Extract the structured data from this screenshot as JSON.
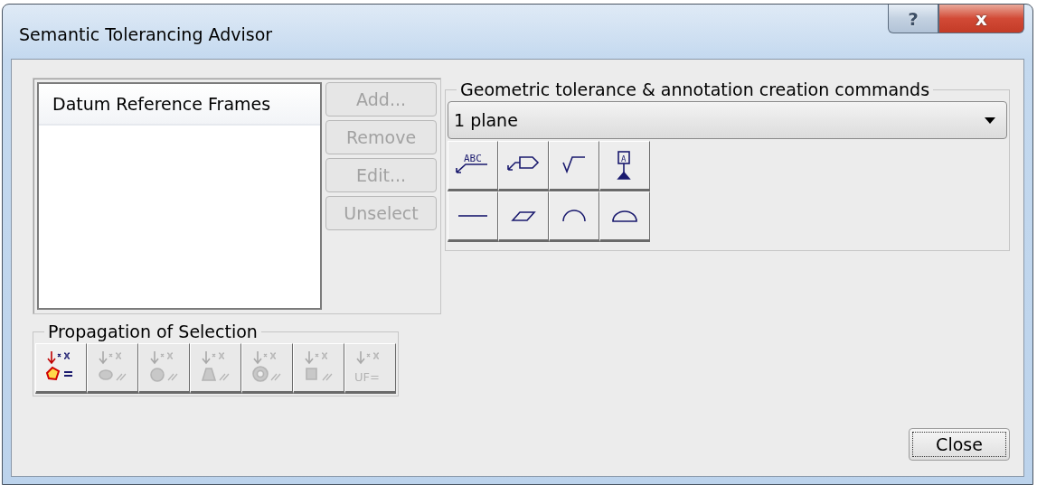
{
  "window": {
    "title": "Semantic Tolerancing Advisor",
    "help": "?",
    "close": "x"
  },
  "list": {
    "items": [
      {
        "label": "Datum Reference Frames",
        "selected": true
      }
    ]
  },
  "list_buttons": [
    {
      "label": "Add...",
      "disabled": true
    },
    {
      "label": "Remove",
      "disabled": true
    },
    {
      "label": "Edit...",
      "disabled": true
    },
    {
      "label": "Unselect",
      "disabled": true
    }
  ],
  "commands": {
    "title": "Geometric tolerance & annotation creation commands",
    "dropdown": {
      "value": "1 plane"
    },
    "tools": [
      {
        "kind": "text-leader",
        "label": "ABC"
      },
      {
        "kind": "flag-leader"
      },
      {
        "kind": "roughness"
      },
      {
        "kind": "datum-target",
        "label": "A"
      },
      {
        "kind": "line"
      },
      {
        "kind": "plane"
      },
      {
        "kind": "arc"
      },
      {
        "kind": "half-disc"
      }
    ]
  },
  "propagation": {
    "title": "Propagation of Selection",
    "tools": [
      {
        "kind": "face",
        "disabled": false
      },
      {
        "kind": "cylinder",
        "disabled": true
      },
      {
        "kind": "sphere",
        "disabled": true
      },
      {
        "kind": "cone",
        "disabled": true
      },
      {
        "kind": "torus",
        "disabled": true
      },
      {
        "kind": "feature",
        "disabled": true
      },
      {
        "kind": "user-feature",
        "label": "UF=",
        "disabled": true
      }
    ]
  },
  "close_button": "Close"
}
